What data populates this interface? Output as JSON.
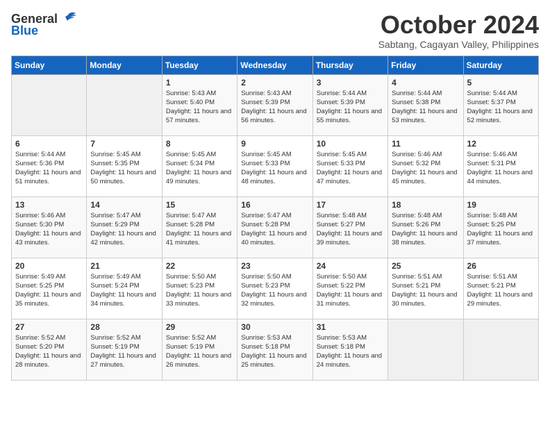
{
  "logo": {
    "general": "General",
    "blue": "Blue"
  },
  "title": "October 2024",
  "subtitle": "Sabtang, Cagayan Valley, Philippines",
  "days_of_week": [
    "Sunday",
    "Monday",
    "Tuesday",
    "Wednesday",
    "Thursday",
    "Friday",
    "Saturday"
  ],
  "weeks": [
    [
      {
        "day": "",
        "info": ""
      },
      {
        "day": "",
        "info": ""
      },
      {
        "day": "1",
        "info": "Sunrise: 5:43 AM\nSunset: 5:40 PM\nDaylight: 11 hours and 57 minutes."
      },
      {
        "day": "2",
        "info": "Sunrise: 5:43 AM\nSunset: 5:39 PM\nDaylight: 11 hours and 56 minutes."
      },
      {
        "day": "3",
        "info": "Sunrise: 5:44 AM\nSunset: 5:39 PM\nDaylight: 11 hours and 55 minutes."
      },
      {
        "day": "4",
        "info": "Sunrise: 5:44 AM\nSunset: 5:38 PM\nDaylight: 11 hours and 53 minutes."
      },
      {
        "day": "5",
        "info": "Sunrise: 5:44 AM\nSunset: 5:37 PM\nDaylight: 11 hours and 52 minutes."
      }
    ],
    [
      {
        "day": "6",
        "info": "Sunrise: 5:44 AM\nSunset: 5:36 PM\nDaylight: 11 hours and 51 minutes."
      },
      {
        "day": "7",
        "info": "Sunrise: 5:45 AM\nSunset: 5:35 PM\nDaylight: 11 hours and 50 minutes."
      },
      {
        "day": "8",
        "info": "Sunrise: 5:45 AM\nSunset: 5:34 PM\nDaylight: 11 hours and 49 minutes."
      },
      {
        "day": "9",
        "info": "Sunrise: 5:45 AM\nSunset: 5:33 PM\nDaylight: 11 hours and 48 minutes."
      },
      {
        "day": "10",
        "info": "Sunrise: 5:45 AM\nSunset: 5:33 PM\nDaylight: 11 hours and 47 minutes."
      },
      {
        "day": "11",
        "info": "Sunrise: 5:46 AM\nSunset: 5:32 PM\nDaylight: 11 hours and 45 minutes."
      },
      {
        "day": "12",
        "info": "Sunrise: 5:46 AM\nSunset: 5:31 PM\nDaylight: 11 hours and 44 minutes."
      }
    ],
    [
      {
        "day": "13",
        "info": "Sunrise: 5:46 AM\nSunset: 5:30 PM\nDaylight: 11 hours and 43 minutes."
      },
      {
        "day": "14",
        "info": "Sunrise: 5:47 AM\nSunset: 5:29 PM\nDaylight: 11 hours and 42 minutes."
      },
      {
        "day": "15",
        "info": "Sunrise: 5:47 AM\nSunset: 5:28 PM\nDaylight: 11 hours and 41 minutes."
      },
      {
        "day": "16",
        "info": "Sunrise: 5:47 AM\nSunset: 5:28 PM\nDaylight: 11 hours and 40 minutes."
      },
      {
        "day": "17",
        "info": "Sunrise: 5:48 AM\nSunset: 5:27 PM\nDaylight: 11 hours and 39 minutes."
      },
      {
        "day": "18",
        "info": "Sunrise: 5:48 AM\nSunset: 5:26 PM\nDaylight: 11 hours and 38 minutes."
      },
      {
        "day": "19",
        "info": "Sunrise: 5:48 AM\nSunset: 5:25 PM\nDaylight: 11 hours and 37 minutes."
      }
    ],
    [
      {
        "day": "20",
        "info": "Sunrise: 5:49 AM\nSunset: 5:25 PM\nDaylight: 11 hours and 35 minutes."
      },
      {
        "day": "21",
        "info": "Sunrise: 5:49 AM\nSunset: 5:24 PM\nDaylight: 11 hours and 34 minutes."
      },
      {
        "day": "22",
        "info": "Sunrise: 5:50 AM\nSunset: 5:23 PM\nDaylight: 11 hours and 33 minutes."
      },
      {
        "day": "23",
        "info": "Sunrise: 5:50 AM\nSunset: 5:23 PM\nDaylight: 11 hours and 32 minutes."
      },
      {
        "day": "24",
        "info": "Sunrise: 5:50 AM\nSunset: 5:22 PM\nDaylight: 11 hours and 31 minutes."
      },
      {
        "day": "25",
        "info": "Sunrise: 5:51 AM\nSunset: 5:21 PM\nDaylight: 11 hours and 30 minutes."
      },
      {
        "day": "26",
        "info": "Sunrise: 5:51 AM\nSunset: 5:21 PM\nDaylight: 11 hours and 29 minutes."
      }
    ],
    [
      {
        "day": "27",
        "info": "Sunrise: 5:52 AM\nSunset: 5:20 PM\nDaylight: 11 hours and 28 minutes."
      },
      {
        "day": "28",
        "info": "Sunrise: 5:52 AM\nSunset: 5:19 PM\nDaylight: 11 hours and 27 minutes."
      },
      {
        "day": "29",
        "info": "Sunrise: 5:52 AM\nSunset: 5:19 PM\nDaylight: 11 hours and 26 minutes."
      },
      {
        "day": "30",
        "info": "Sunrise: 5:53 AM\nSunset: 5:18 PM\nDaylight: 11 hours and 25 minutes."
      },
      {
        "day": "31",
        "info": "Sunrise: 5:53 AM\nSunset: 5:18 PM\nDaylight: 11 hours and 24 minutes."
      },
      {
        "day": "",
        "info": ""
      },
      {
        "day": "",
        "info": ""
      }
    ]
  ]
}
